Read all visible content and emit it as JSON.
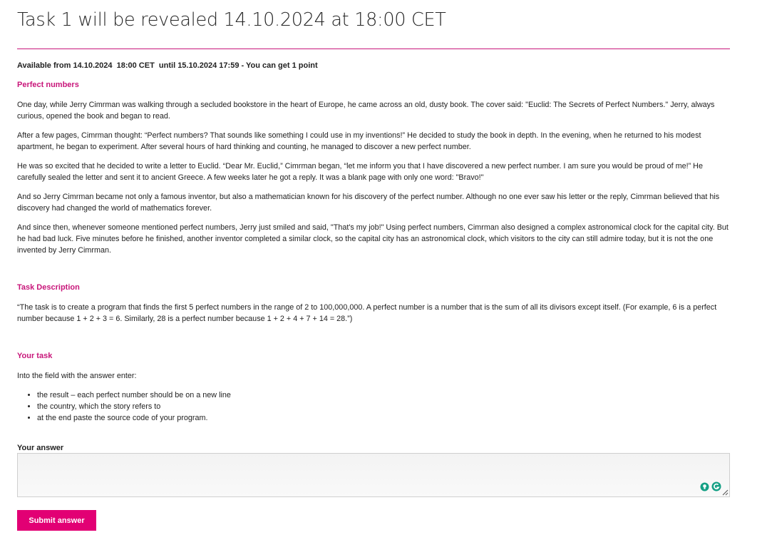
{
  "page": {
    "title": "Task 1 will be revealed 14.10.2024 at 18:00 CET",
    "availability": "Available from 14.10.2024  18:00 CET  until 15.10.2024 17:59 - You can get 1 point"
  },
  "story": {
    "heading": "Perfect numbers",
    "paragraphs": [
      "One day, while Jerry Cimrman was walking through a secluded bookstore in the heart of Europe, he came across an old, dusty book. The cover said: \"Euclid: The Secrets of Perfect Numbers.\" Jerry, always curious, opened the book and began to read.",
      "After a few pages, Cimrman thought: “Perfect numbers? That sounds like something I could use in my inventions!” He decided to study the book in depth. In the evening, when he returned to his modest apartment, he began to experiment. After several hours of hard thinking and counting, he managed to discover a new perfect number.",
      "He was so excited that he decided to write a letter to Euclid. “Dear Mr. Euclid,” Cimrman began, “let me inform you that I have discovered a new perfect number. I am sure you would be proud of me!” He carefully sealed the letter and sent it to ancient Greece. A few weeks later he got a reply. It was a blank page with only one word: \"Bravo!\"",
      "And so Jerry Cimrman became not only a famous inventor, but also a mathematician known for his discovery of the perfect number. Although no one ever saw his letter or the reply, Cimrman believed  that his discovery had changed the world of mathematics forever.",
      "And since then, whenever someone mentioned perfect numbers, Jerry just smiled and said, \"That's my job!\" Using perfect numbers, Cimrman also designed a complex astronomical clock for the capital city. But he had bad luck. Five minutes before he finished, another inventor completed a similar clock, so the capital city has an astronomical clock, which visitors to the city can still admire today, but it is not the one invented by Jerry Cimrman."
    ]
  },
  "task_description": {
    "heading": "Task Description",
    "text": "“The task is to create a program that finds the first 5 perfect numbers in the range of 2 to 100,000,000. A perfect number is a number that is the sum of all its divisors except itself. (For example, 6 is a perfect number because 1 + 2 + 3 = 6. Similarly, 28 is a perfect number because 1 + 2 + 4 + 7 + 14 = 28.”)"
  },
  "your_task": {
    "heading": "Your task",
    "intro": "Into the field with the answer enter:",
    "items": [
      "the result – each perfect number should be on a new line",
      "the country, which the story refers to",
      "at the end paste the source code of your program."
    ]
  },
  "answer": {
    "label": "Your answer",
    "value": "",
    "submit_label": "Submit answer"
  },
  "colors": {
    "accent": "#c8167a",
    "button": "#e20074",
    "grammarly": "#15a085"
  },
  "icons": [
    "lightbulb-icon",
    "grammarly-icon",
    "resize-handle-icon"
  ]
}
